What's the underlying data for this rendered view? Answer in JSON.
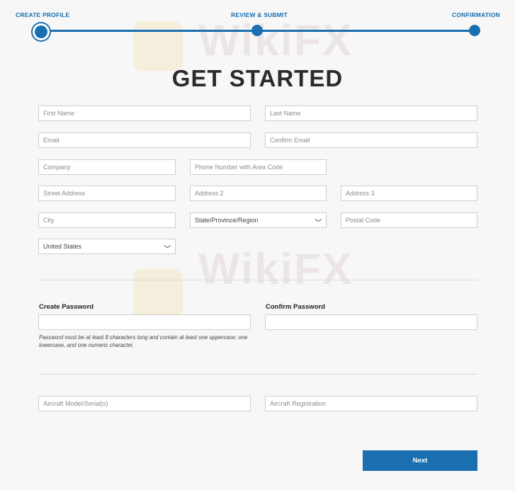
{
  "stepper": {
    "steps": [
      "CREATE PROFILE",
      "REVIEW & SUBMIT",
      "CONFIRMATION"
    ],
    "active_step": 1
  },
  "title": "GET STARTED",
  "form": {
    "first_name": "First Name",
    "last_name": "Last Name",
    "email": "Email",
    "confirm_email": "Confirm Email",
    "company": "Company",
    "phone": "Phone Number with Area Code",
    "street": "Street Address",
    "address2": "Address 2",
    "address3": "Address 3",
    "city": "City",
    "state": "State/Province/Region",
    "postal": "Postal Code",
    "country": "United States"
  },
  "password": {
    "create_label": "Create Password",
    "confirm_label": "Confirm Password",
    "hint": "Password must be at least 8 characters long and contain at least one uppercase, one lowercase, and one numeric character."
  },
  "aircraft": {
    "model": "Aircraft Model/Serial(s)",
    "registration": "Aircraft Registration"
  },
  "buttons": {
    "next": "Next"
  },
  "watermark": "WikiFX",
  "colors": {
    "accent": "#1a6fb0"
  }
}
